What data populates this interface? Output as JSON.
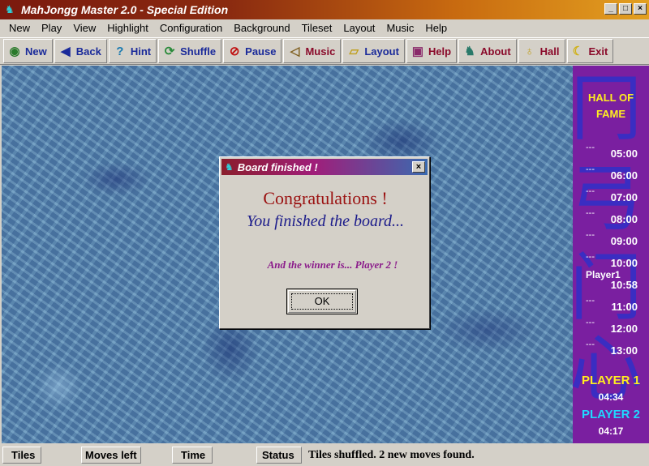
{
  "window": {
    "title": "MahJongg Master 2.0 - Special Edition"
  },
  "menu": [
    "New",
    "Play",
    "View",
    "Highlight",
    "Configuration",
    "Background",
    "Tileset",
    "Layout",
    "Music",
    "Help"
  ],
  "toolbar": {
    "new": "New",
    "back": "Back",
    "hint": "Hint",
    "shuffle": "Shuffle",
    "pause": "Pause",
    "music": "Music",
    "layout": "Layout",
    "help": "Help",
    "about": "About",
    "hall": "Hall",
    "exit": "Exit"
  },
  "hall_of_fame": {
    "title_line1": "HALL OF",
    "title_line2": "FAME",
    "entries": [
      {
        "name": "---",
        "time": "05:00"
      },
      {
        "name": "---",
        "time": "06:00"
      },
      {
        "name": "---",
        "time": "07:00"
      },
      {
        "name": "---",
        "time": "08:00"
      },
      {
        "name": "---",
        "time": "09:00"
      },
      {
        "name": "---",
        "time": "10:00"
      },
      {
        "name": "Player1",
        "time": "10:58"
      },
      {
        "name": "---",
        "time": "11:00"
      },
      {
        "name": "---",
        "time": "12:00"
      },
      {
        "name": "---",
        "time": "13:00"
      }
    ],
    "player1_label": "PLAYER 1",
    "player1_time": "04:34",
    "player2_label": "PLAYER 2",
    "player2_time": "04:17",
    "colors": {
      "player1": "#ffee20",
      "player2": "#20d8ff",
      "background": "#7a1fa0"
    }
  },
  "statusbar": {
    "tiles": "Tiles",
    "moves_left": "Moves left",
    "time": "Time",
    "status": "Status",
    "status_text": "Tiles shuffled. 2 new moves found."
  },
  "dialog": {
    "title": "Board finished !",
    "congrats": "Congratulations !",
    "finished": "You finished the board...",
    "winner": "And the winner is... Player 2 !",
    "ok": "OK"
  }
}
